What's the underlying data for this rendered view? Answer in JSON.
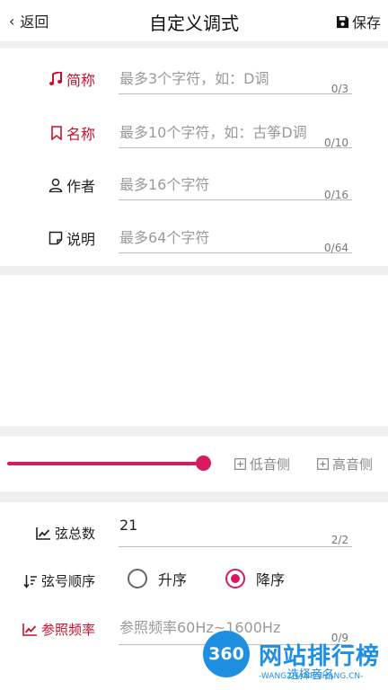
{
  "header": {
    "back_label": "返回",
    "title": "自定义调式",
    "save_label": "保存"
  },
  "form": {
    "short_name": {
      "label": "简称",
      "placeholder": "最多3个字符，如：D调",
      "counter": "0/3"
    },
    "name": {
      "label": "名称",
      "placeholder": "最多10个字符，如：古筝D调",
      "counter": "0/10"
    },
    "author": {
      "label": "作者",
      "placeholder": "最多16个字符",
      "counter": "0/16"
    },
    "description": {
      "label": "说明",
      "placeholder": "最多64个字符",
      "counter": "0/64"
    }
  },
  "slider": {
    "level": 1.0,
    "low_label": "低音侧",
    "high_label": "高音侧"
  },
  "strings": {
    "total_label": "弦总数",
    "total_value": "21",
    "total_counter": "2/2",
    "order_label": "弦号顺序",
    "order_options": [
      "升序",
      "降序"
    ],
    "order_selected": "降序",
    "freq_label": "参照频率",
    "freq_placeholder": "参照频率60Hz~1600Hz",
    "freq_counter": "0/9"
  },
  "watermark": {
    "logo": "360",
    "brand": "网站排行榜",
    "domain": "-WANGZHANPAIHANG.CN-",
    "slogan": "选择音名"
  },
  "colors": {
    "accent": "#d81b60",
    "label_red": "#c8102e",
    "watermark_blue": "#1e8fe1"
  }
}
